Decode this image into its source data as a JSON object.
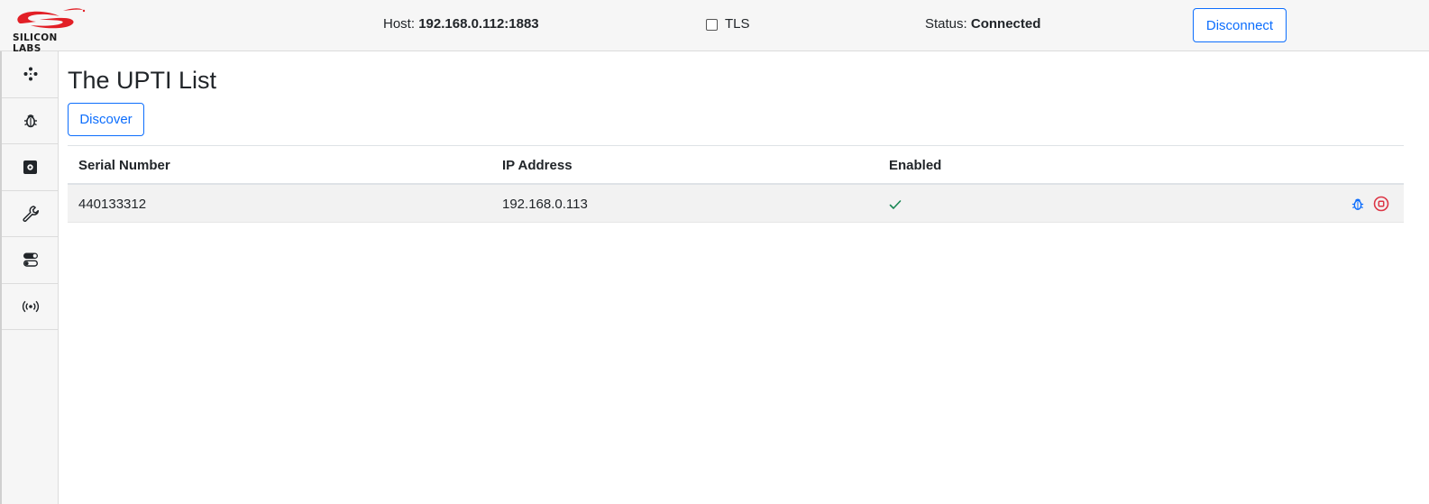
{
  "header": {
    "logo_text": "SILICON LABS",
    "host_label": "Host:",
    "host_value": "192.168.0.112:1883",
    "tls_label": "TLS",
    "status_label": "Status:",
    "status_value": "Connected",
    "disconnect_label": "Disconnect"
  },
  "sidebar": {
    "items": [
      {
        "icon": "network-nodes-icon"
      },
      {
        "icon": "bug-icon"
      },
      {
        "icon": "chip-icon"
      },
      {
        "icon": "wrench-icon"
      },
      {
        "icon": "toggles-icon"
      },
      {
        "icon": "broadcast-icon"
      }
    ]
  },
  "main": {
    "title": "The UPTI List",
    "discover_label": "Discover",
    "table": {
      "headers": [
        "Serial Number",
        "IP Address",
        "Enabled"
      ],
      "rows": [
        {
          "serial": "440133312",
          "ip": "192.168.0.113",
          "enabled": true
        }
      ]
    }
  },
  "colors": {
    "accent": "#0d6efd",
    "success": "#198754",
    "danger": "#dc3545",
    "logo_red": "#e21f26"
  }
}
